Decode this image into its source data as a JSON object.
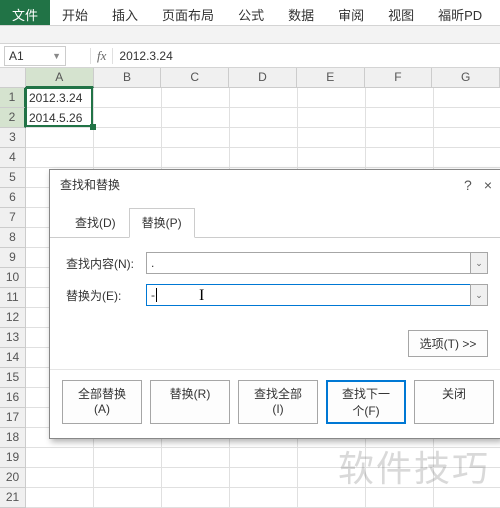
{
  "ribbon": {
    "file": "文件",
    "tabs": [
      "开始",
      "插入",
      "页面布局",
      "公式",
      "数据",
      "审阅",
      "视图",
      "福昕PD"
    ]
  },
  "namebox": "A1",
  "fx_label": "fx",
  "formula_value": "2012.3.24",
  "columns": [
    "A",
    "B",
    "C",
    "D",
    "E",
    "F",
    "G"
  ],
  "rows": [
    "1",
    "2",
    "3",
    "4",
    "5",
    "6",
    "7",
    "8",
    "9",
    "10",
    "11",
    "12",
    "13",
    "14",
    "15",
    "16",
    "17",
    "18",
    "19",
    "20",
    "21"
  ],
  "cells": {
    "A1": "2012.3.24",
    "A2": "2014.5.26"
  },
  "dialog": {
    "title": "查找和替换",
    "help": "?",
    "close": "×",
    "tabs": {
      "find": "查找(D)",
      "replace": "替换(P)"
    },
    "find_label": "查找内容(N):",
    "find_value": ".",
    "replace_label": "替换为(E):",
    "replace_value": "-",
    "options_btn": "选项(T) >>",
    "buttons": {
      "replace_all": "全部替换(A)",
      "replace": "替换(R)",
      "find_all": "查找全部(I)",
      "find_next": "查找下一个(F)",
      "close": "关闭"
    }
  },
  "watermark": "软件技巧"
}
